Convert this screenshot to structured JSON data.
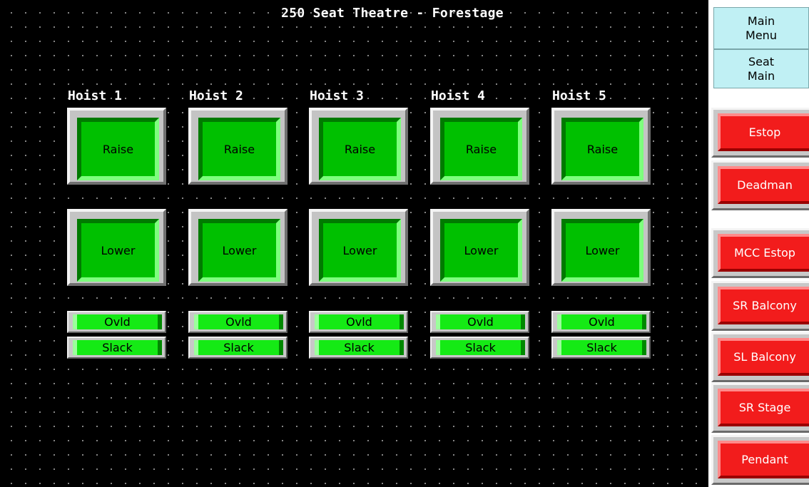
{
  "title": "250 Seat Theatre - Forestage",
  "hoists": [
    {
      "label": "Hoist 1",
      "raise": "Raise",
      "lower": "Lower",
      "ovld": "Ovld",
      "slack": "Slack"
    },
    {
      "label": "Hoist 2",
      "raise": "Raise",
      "lower": "Lower",
      "ovld": "Ovld",
      "slack": "Slack"
    },
    {
      "label": "Hoist 3",
      "raise": "Raise",
      "lower": "Lower",
      "ovld": "Ovld",
      "slack": "Slack"
    },
    {
      "label": "Hoist 4",
      "raise": "Raise",
      "lower": "Lower",
      "ovld": "Ovld",
      "slack": "Slack"
    },
    {
      "label": "Hoist 5",
      "raise": "Raise",
      "lower": "Lower",
      "ovld": "Ovld",
      "slack": "Slack"
    }
  ],
  "nav": {
    "main_menu": "Main Menu",
    "seat_main": "Seat Main"
  },
  "status_buttons": [
    "Estop",
    "Deadman",
    "MCC Estop",
    "SR Balcony",
    "SL Balcony",
    "SR Stage",
    "Pendant"
  ],
  "colors": {
    "background": "#000000",
    "button_green": "#00c000",
    "indicator_green": "#15ea15",
    "alarm_red": "#f21c1c",
    "nav_cyan": "#c0f0f4"
  }
}
